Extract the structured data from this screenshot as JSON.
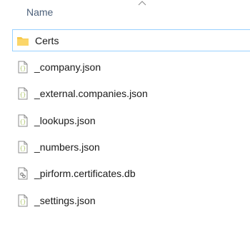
{
  "header": {
    "column_name": "Name",
    "sort_icon": "chevron-up-icon"
  },
  "items": [
    {
      "label": "Certs",
      "icon": "folder-icon",
      "selected": true
    },
    {
      "label": "_company.json",
      "icon": "json-file-icon"
    },
    {
      "label": "_external.companies.json",
      "icon": "json-file-icon"
    },
    {
      "label": "_lookups.json",
      "icon": "json-file-icon"
    },
    {
      "label": "_numbers.json",
      "icon": "json-file-icon"
    },
    {
      "label": "_pirform.certificates.db",
      "icon": "db-file-icon"
    },
    {
      "label": "_settings.json",
      "icon": "json-file-icon"
    }
  ],
  "colors": {
    "folder": "#f8c94a",
    "selection_border": "#99d1ff",
    "header_text": "#4c607a",
    "json_brace": "#9bb84a"
  }
}
